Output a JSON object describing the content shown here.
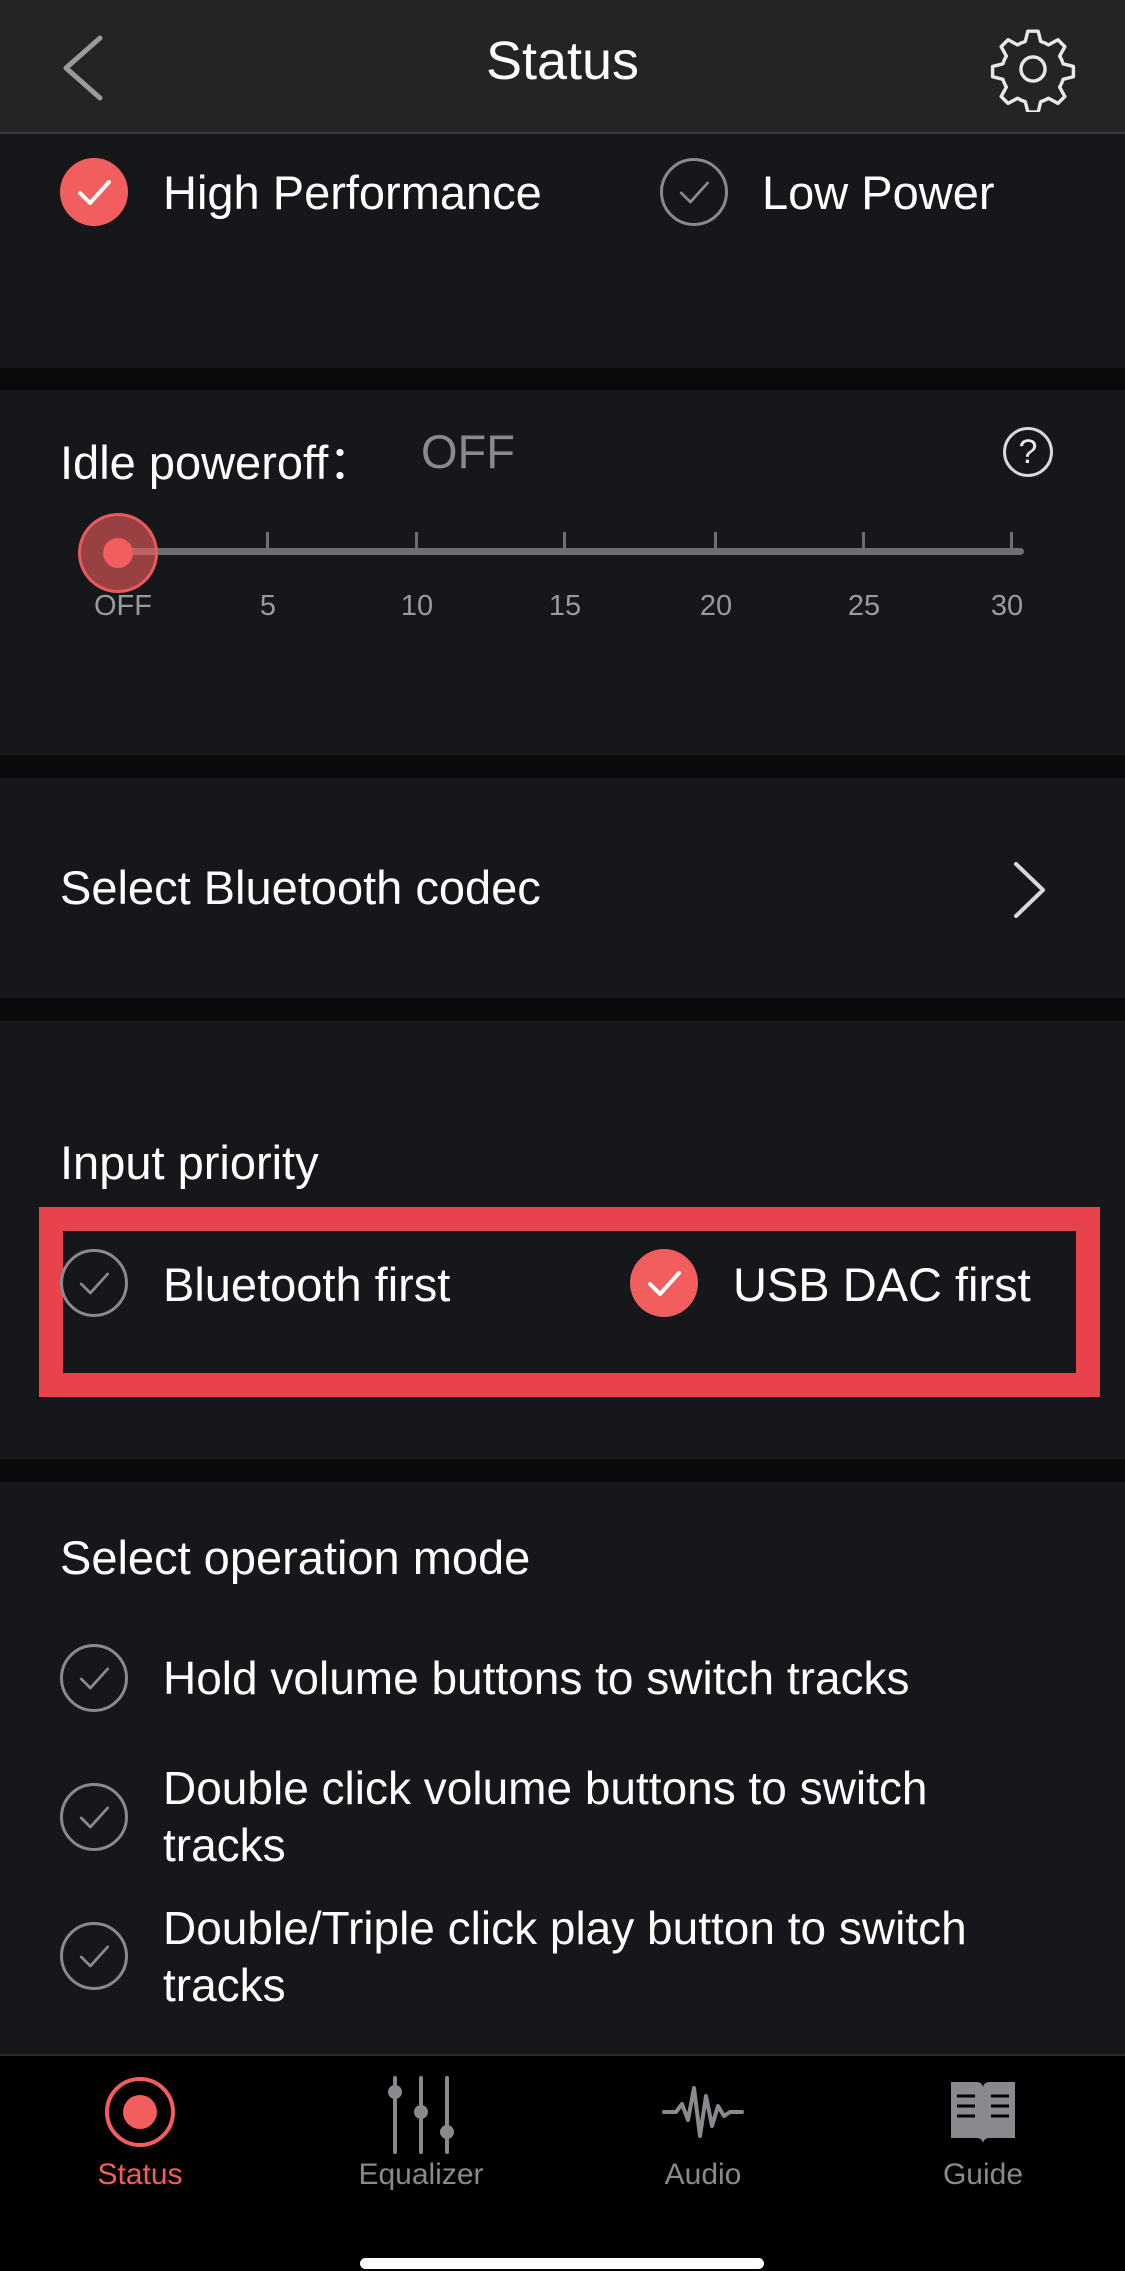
{
  "header": {
    "title": "Status",
    "back_icon": "chevron-left-icon",
    "settings_icon": "gear-icon"
  },
  "power_mode": {
    "options": [
      {
        "label": "High Performance",
        "checked": true
      },
      {
        "label": "Low Power",
        "checked": false
      }
    ]
  },
  "idle_poweroff": {
    "label": "Idle poweroff：",
    "value": "OFF",
    "help_symbol": "?",
    "ticks": [
      "OFF",
      "5",
      "10",
      "15",
      "20",
      "25",
      "30"
    ],
    "slider_level": 0
  },
  "bluetooth_codec": {
    "label": "Select Bluetooth codec"
  },
  "input_priority": {
    "title": "Input priority",
    "options": [
      {
        "label": "Bluetooth first",
        "checked": false
      },
      {
        "label": "USB DAC first",
        "checked": true
      }
    ]
  },
  "operation_mode": {
    "title": "Select operation mode",
    "options": [
      {
        "label": "Hold volume buttons to switch tracks",
        "checked": false
      },
      {
        "label": "Double click volume buttons to switch tracks",
        "checked": false
      },
      {
        "label": "Double/Triple click play button to switch tracks",
        "checked": false
      }
    ]
  },
  "tabs": [
    {
      "label": "Status",
      "icon": "status-record-icon",
      "active": true
    },
    {
      "label": "Equalizer",
      "icon": "equalizer-sliders-icon",
      "active": false
    },
    {
      "label": "Audio",
      "icon": "audio-waveform-icon",
      "active": false
    },
    {
      "label": "Guide",
      "icon": "book-icon",
      "active": false
    }
  ],
  "colors": {
    "accent": "#f25e5e",
    "highlight": "#e8434c",
    "background": "#16171b"
  }
}
